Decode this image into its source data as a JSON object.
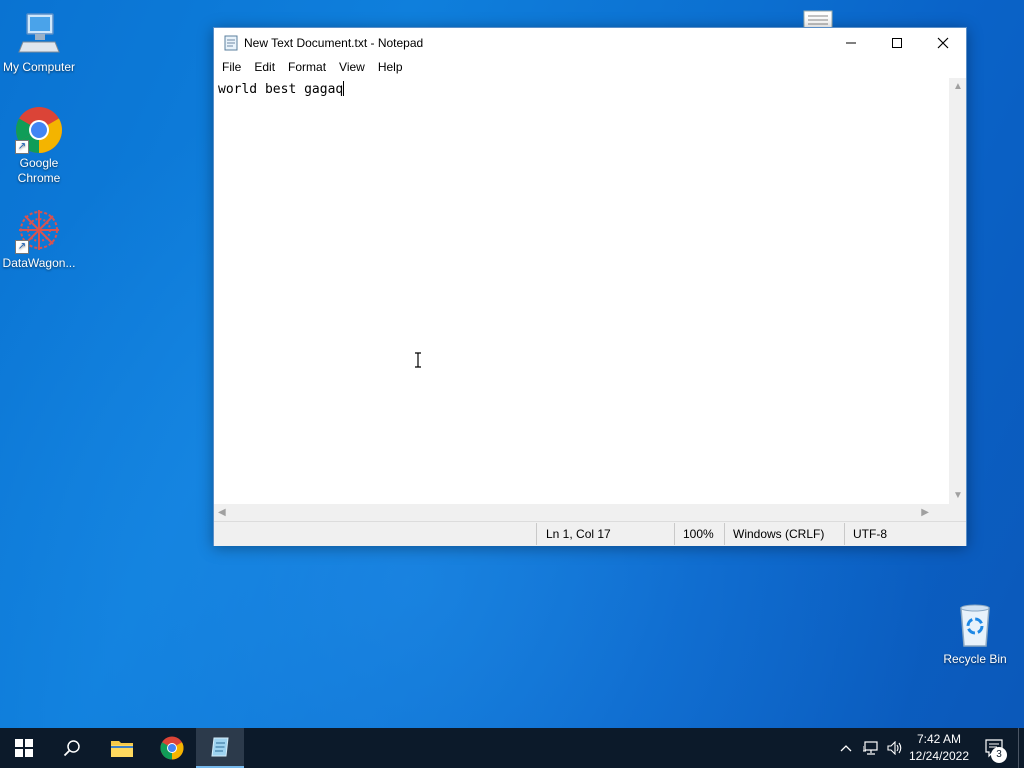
{
  "desktop": {
    "icons": [
      {
        "label": "My Computer"
      },
      {
        "label": "Google Chrome"
      },
      {
        "label": "DataWagon..."
      },
      {
        "label": "Recycle Bin"
      }
    ]
  },
  "notepad": {
    "title": "New Text Document.txt - Notepad",
    "menu": [
      "File",
      "Edit",
      "Format",
      "View",
      "Help"
    ],
    "content": "world best gagaq",
    "status": {
      "position": "Ln 1, Col 17",
      "zoom": "100%",
      "line_ending": "Windows (CRLF)",
      "encoding": "UTF-8"
    }
  },
  "taskbar": {
    "time": "7:42 AM",
    "date": "12/24/2022",
    "notification_count": "3"
  },
  "colors": {
    "desktop_blue": "#0a73d2",
    "taskbar_bg": "#0c1a2a",
    "active_indicator": "#76b9ed"
  }
}
